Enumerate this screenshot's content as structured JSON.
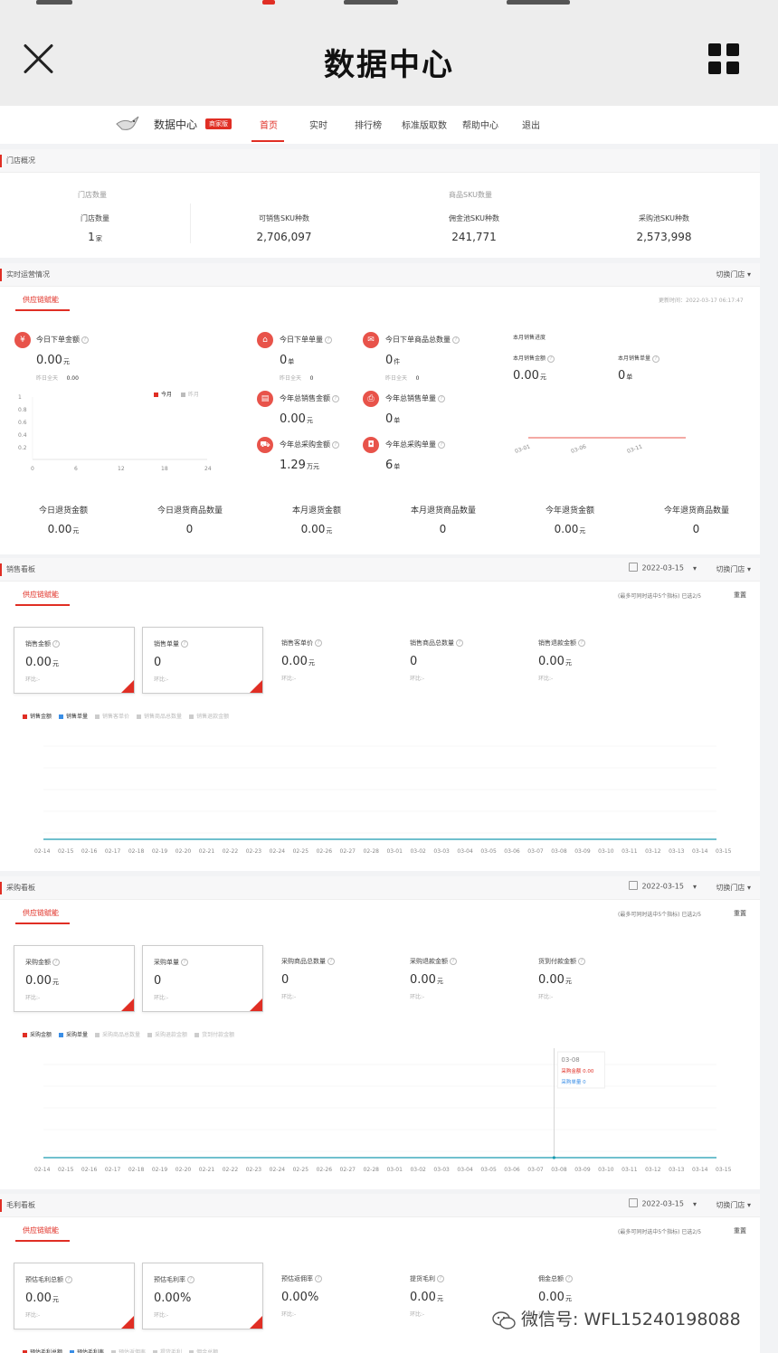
{
  "appbar": {
    "title": "数据中心"
  },
  "nav": {
    "brand": "数据中心",
    "badge": "商家版",
    "items": [
      "首页",
      "实时",
      "排行榜",
      "标准版取数",
      "帮助中心",
      "退出"
    ]
  },
  "overview": {
    "section_label": "门店概况",
    "group_store": "门店数量",
    "group_sku": "商品SKU数量",
    "metrics": [
      {
        "title": "门店数量",
        "value": "1",
        "unit": "家"
      },
      {
        "title": "可销售SKU种数",
        "value": "2,706,097",
        "unit": ""
      },
      {
        "title": "佣金池SKU种数",
        "value": "241,771",
        "unit": ""
      },
      {
        "title": "采购池SKU种数",
        "value": "2,573,998",
        "unit": ""
      }
    ]
  },
  "realtime": {
    "section_label": "实时运营情况",
    "switch_label": "切换门店",
    "subtab": "供应链赋能",
    "update_time": "更新时间：2022-03-17 06:17:47",
    "today_sales": {
      "title": "今日下单金额",
      "value": "0.00",
      "unit": "元",
      "yesterday_label": "昨日全天",
      "yesterday_value": "0.00"
    },
    "legend_today": "今月",
    "legend_yesterday": "昨月",
    "mini_chart": {
      "y_ticks": [
        "1",
        "0.8",
        "0.6",
        "0.4",
        "0.2"
      ],
      "x_ticks": [
        "0",
        "6",
        "12",
        "18",
        "24"
      ]
    },
    "metrics": [
      {
        "title": "今日下单单量",
        "value": "0",
        "unit": "单",
        "sub_label": "昨日全天",
        "sub_value": "0",
        "icon": "cart-icon"
      },
      {
        "title": "今日下单商品总数量",
        "value": "0",
        "unit": "件",
        "sub_label": "昨日全天",
        "sub_value": "0",
        "icon": "box-icon"
      },
      {
        "title": "今年总销售金额",
        "value": "0.00",
        "unit": "元",
        "icon": "wallet-icon"
      },
      {
        "title": "今年总销售单量",
        "value": "0",
        "unit": "单",
        "icon": "printer-icon"
      },
      {
        "title": "今年总采购金额",
        "value": "1.29",
        "unit": "万元",
        "icon": "purchase-cart-icon"
      },
      {
        "title": "今年总采购单量",
        "value": "6",
        "unit": "单",
        "icon": "bag-icon"
      }
    ],
    "month_progress": {
      "title": "本月销售进度",
      "sales_title": "本月销售金额",
      "sales_value": "0.00",
      "sales_unit": "元",
      "orders_title": "本月销售单量",
      "orders_value": "0",
      "orders_unit": "单",
      "x_ticks": [
        "03-01",
        "03-06",
        "03-11"
      ]
    },
    "refunds": [
      {
        "title": "今日退货金额",
        "value": "0.00",
        "unit": "元"
      },
      {
        "title": "今日退货商品数量",
        "value": "0",
        "unit": ""
      },
      {
        "title": "本月退货金额",
        "value": "0.00",
        "unit": "元"
      },
      {
        "title": "本月退货商品数量",
        "value": "0",
        "unit": ""
      },
      {
        "title": "今年退货金额",
        "value": "0.00",
        "unit": "元"
      },
      {
        "title": "今年退货商品数量",
        "value": "0",
        "unit": ""
      }
    ]
  },
  "boards": {
    "date": "2022-03-15",
    "switch_label": "切换门店",
    "subtab": "供应链赋能",
    "hint": "(最多可同时选中5个指标) 已选2/5",
    "reset": "重置",
    "compare": "环比:-",
    "x_ticks": [
      "02-14",
      "02-15",
      "02-16",
      "02-17",
      "02-18",
      "02-19",
      "02-20",
      "02-21",
      "02-22",
      "02-23",
      "02-24",
      "02-25",
      "02-26",
      "02-27",
      "02-28",
      "03-01",
      "03-02",
      "03-03",
      "03-04",
      "03-05",
      "03-06",
      "03-07",
      "03-08",
      "03-09",
      "03-10",
      "03-11",
      "03-12",
      "03-13",
      "03-14",
      "03-15"
    ],
    "sales": {
      "section_label": "销售看板",
      "cards": [
        {
          "title": "销售金额",
          "value": "0.00",
          "unit": "元"
        },
        {
          "title": "销售单量",
          "value": "0",
          "unit": ""
        },
        {
          "title": "销售客单价",
          "value": "0.00",
          "unit": "元"
        },
        {
          "title": "销售商品总数量",
          "value": "0",
          "unit": ""
        },
        {
          "title": "销售退款金额",
          "value": "0.00",
          "unit": "元"
        }
      ],
      "legend": [
        "销售金额",
        "销售单量",
        "销售客单价",
        "销售商品总数量",
        "销售退款金额"
      ]
    },
    "purchase": {
      "section_label": "采购看板",
      "cards": [
        {
          "title": "采购金额",
          "value": "0.00",
          "unit": "元"
        },
        {
          "title": "采购单量",
          "value": "0",
          "unit": ""
        },
        {
          "title": "采购商品总数量",
          "value": "0",
          "unit": ""
        },
        {
          "title": "采购退款金额",
          "value": "0.00",
          "unit": "元"
        },
        {
          "title": "货到付款金额",
          "value": "0.00",
          "unit": "元"
        }
      ],
      "legend": [
        "采购金额",
        "采购单量",
        "采购商品总数量",
        "采购退款金额",
        "货到付款金额"
      ],
      "tooltip": {
        "date": "03-08",
        "line1": "采购金额 0.00",
        "line2": "采购单量 0"
      }
    },
    "profit": {
      "section_label": "毛利看板",
      "cards": [
        {
          "title": "预估毛利总额",
          "value": "0.00",
          "unit": "元"
        },
        {
          "title": "预估毛利率",
          "value": "0.00%",
          "unit": ""
        },
        {
          "title": "预估返佣率",
          "value": "0.00%",
          "unit": ""
        },
        {
          "title": "提货毛利",
          "value": "0.00",
          "unit": "元"
        },
        {
          "title": "佣金总额",
          "value": "0.00",
          "unit": "元"
        }
      ],
      "legend": [
        "预估毛利总额",
        "预估毛利率",
        "预估返佣率",
        "提货毛利",
        "佣金总额"
      ]
    }
  },
  "colors": {
    "accent": "#e02e24",
    "series2": "#3a8ee6",
    "line": "#1a9bb0"
  },
  "watermark": "微信号: WFL15240198088"
}
